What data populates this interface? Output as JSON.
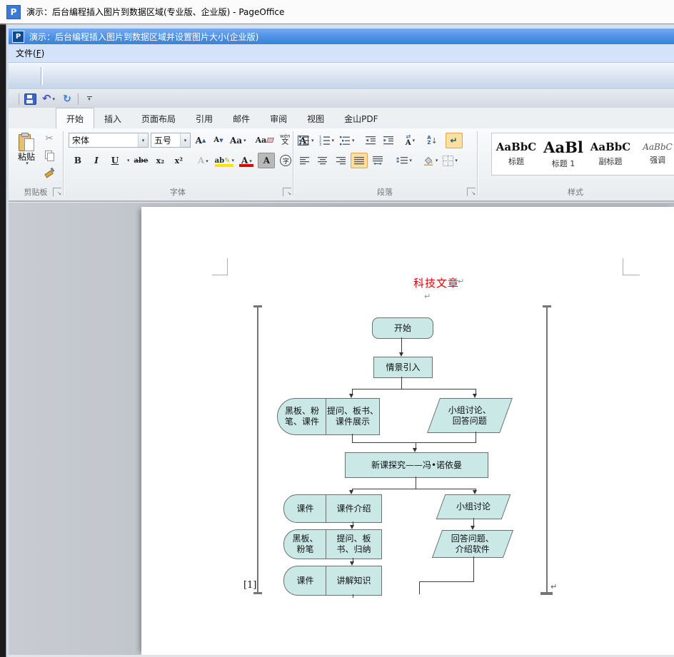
{
  "window": {
    "logo": "P",
    "title": "演示：后台编程插入图片到数据区域(专业版、企业版) - PageOffice"
  },
  "app": {
    "titlebar": {
      "logo": "P",
      "title": "演示：后台编程插入图片到数据区域并设置图片大小(企业版)"
    },
    "menubar": {
      "file_pre": "文件(",
      "file_key": "F",
      "file_post": ")"
    }
  },
  "icons": {
    "dropdown": "▾",
    "undo": "↶",
    "redo": "↻",
    "scissors": "✂",
    "pilcrow": "↵",
    "launcher": "↘",
    "updown": "↕",
    "swap": "⇄",
    "down_arrow": "↓"
  },
  "ribbon": {
    "tabs": [
      {
        "label": "开始",
        "active": true
      },
      {
        "label": "插入"
      },
      {
        "label": "页面布局"
      },
      {
        "label": "引用"
      },
      {
        "label": "邮件"
      },
      {
        "label": "审阅"
      },
      {
        "label": "视图"
      },
      {
        "label": "金山PDF"
      }
    ],
    "clipboard": {
      "label": "剪贴板",
      "paste": "粘贴"
    },
    "font": {
      "label": "字体",
      "font_name": "宋体",
      "font_size": "五号",
      "grow": "A",
      "shrink": "A",
      "case": "Aa",
      "clear": "Aa",
      "pinyin_top": "wén",
      "pinyin_bottom": "文",
      "char_border": "A",
      "bold": "B",
      "italic": "I",
      "underline": "U",
      "strike": "abe",
      "subscript": "x₂",
      "superscript": "x²",
      "effects": "A",
      "highlight": "ab",
      "color": "A",
      "shade": "A",
      "enclose": "字"
    },
    "paragraph": {
      "label": "段落",
      "sort_top": "A",
      "sort_bottom": "Z"
    },
    "styles": {
      "label": "样式",
      "items": [
        {
          "preview": "AaBbC",
          "name": "标题"
        },
        {
          "preview": "AaBl",
          "name": "标题 1"
        },
        {
          "preview": "AaBbC",
          "name": "副标题"
        },
        {
          "preview": "AaBbC",
          "name": "强调"
        }
      ]
    }
  },
  "document": {
    "title": "科技文章",
    "footnote_mark": "[1]",
    "flowchart": {
      "fill": "#c9e8e6",
      "border": "#6e6e6e",
      "nodes": {
        "start": "开始",
        "intro": "情景引入",
        "tool1": "黑板、粉\n笔、课件",
        "step1": "提问、板书、\n课件展示",
        "discuss1": "小组讨论、\n回答问题",
        "main": "新课探究——冯•诺依曼",
        "tool2": "课件",
        "step2": "课件介绍",
        "discuss2": "小组讨论",
        "tool3": "黑板、\n粉笔",
        "step3": "提问、板\n书、归纳",
        "discuss3": "回答问题、\n介绍软件",
        "tool4": "课件",
        "step4": "讲解知识"
      }
    }
  }
}
